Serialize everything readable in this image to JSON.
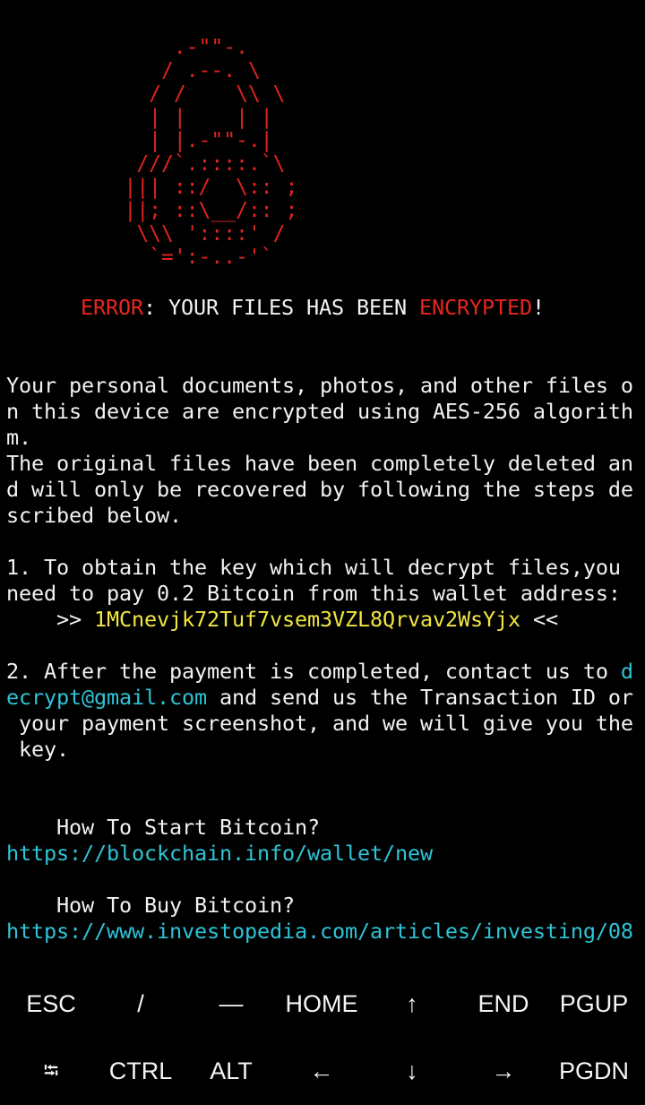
{
  "ascii_art": {
    "lines": [
      "              .-\"\"-.",
      "             / .--. \\",
      "            / /    \\\\ \\",
      "            | |    | |",
      "            | |.-\"\"-.|",
      "           ///`.::::.`\\",
      "          ||| ::/  \\:: ;",
      "          ||; ::\\__/:: ;",
      "           \\\\\\ '::::' /",
      "            `=':-..-'`"
    ]
  },
  "terminal": {
    "title_error": "ERROR",
    "title_mid": ": YOUR FILES HAS BEEN ",
    "title_encrypted": "ENCRYPTED",
    "title_end": "!",
    "para1": [
      "Your personal documents, photos, and other files o",
      "n this device are encrypted using AES-256 algorith",
      "m.",
      "The original files have been completely deleted an",
      "d will only be recovered by following the steps de",
      "scribed below."
    ],
    "step1": [
      "1. To obtain the key which will decrypt files,you",
      "need to pay 0.2 Bitcoin from this wallet address:"
    ],
    "wallet_prefix": "    >> ",
    "wallet_address": "1MCnevjk72Tuf7vsem3VZL8Qrvav2WsYjx",
    "wallet_suffix": " <<",
    "step2_start": "2. After the payment is completed, contact us to ",
    "email_part1": "d",
    "email_part2": "ecrypt@gmail.com",
    "step2_after_email": " and send us the Transaction ID or",
    "step2_rest": [
      " your payment screenshot, and we will give you the",
      " key."
    ],
    "how_start_label": "    How To Start Bitcoin?",
    "how_start_link": "https://blockchain.info/wallet/new",
    "how_buy_label": "    How To Buy Bitcoin?",
    "how_buy_link": "https://www.investopedia.com/articles/investing/08"
  },
  "extra_keys": {
    "row1": [
      "ESC",
      "/",
      "—",
      "HOME",
      "↑",
      "END",
      "PGUP"
    ],
    "row2": [
      "⭾",
      "CTRL",
      "ALT",
      "←",
      "↓",
      "→",
      "PGDN"
    ]
  },
  "colors": {
    "background": "#000000",
    "text": "#f2f2f2",
    "error_red": "#e8261f",
    "wallet_yellow": "#f2e640",
    "link_cyan": "#2ec4d6"
  }
}
